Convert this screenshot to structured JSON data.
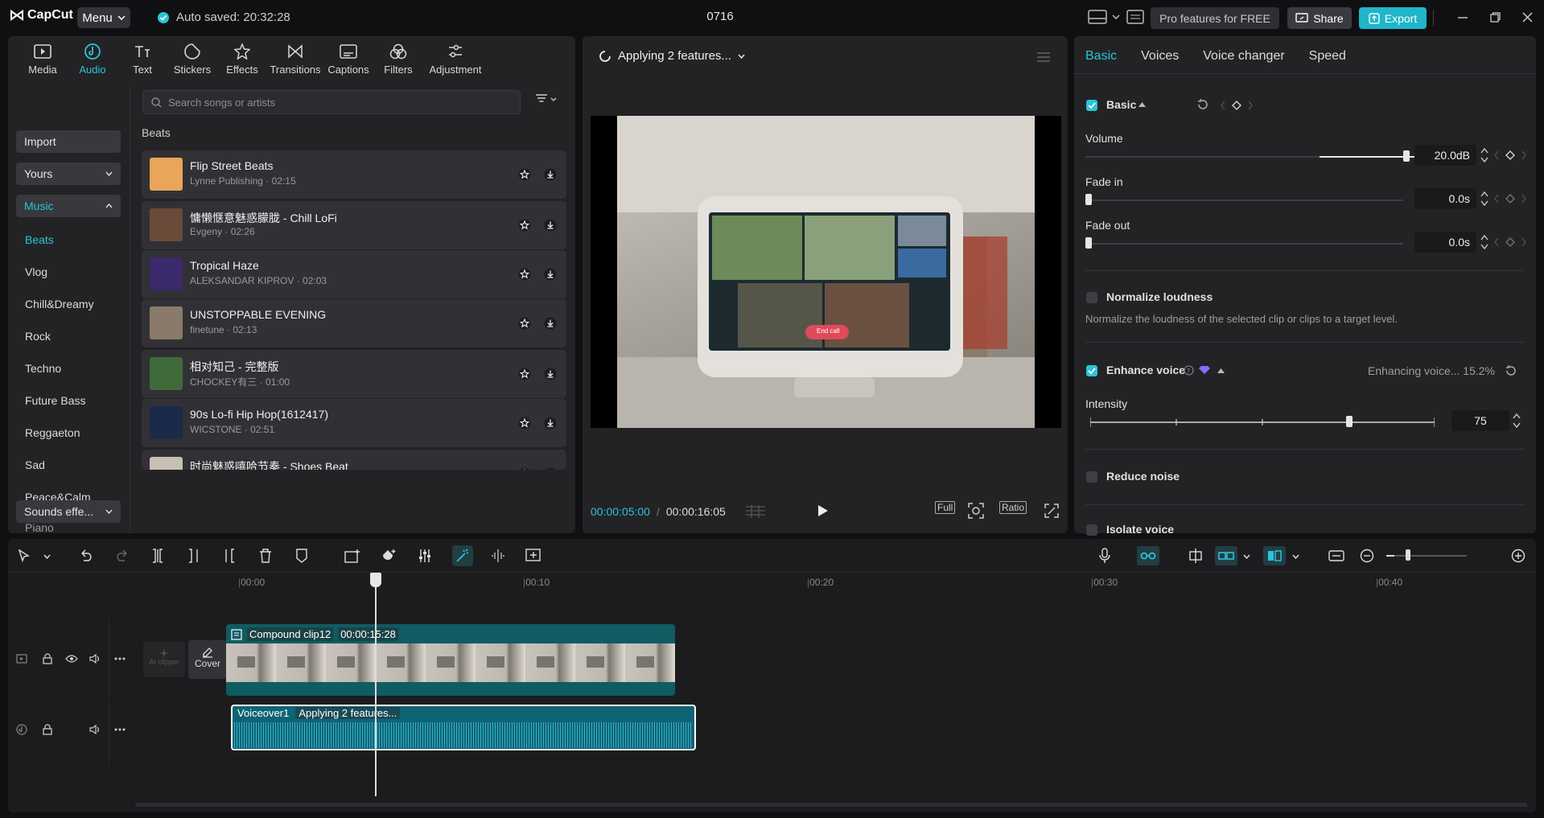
{
  "titlebar": {
    "logo": "CapCut",
    "menu": "Menu",
    "autosave": "Auto saved: 20:32:28",
    "project": "0716",
    "pro": "Pro features for FREE",
    "share": "Share",
    "export": "Export"
  },
  "tabs": [
    {
      "label": "Media",
      "icon": "media-icon"
    },
    {
      "label": "Audio",
      "icon": "audio-icon",
      "active": true
    },
    {
      "label": "Text",
      "icon": "text-icon"
    },
    {
      "label": "Stickers",
      "icon": "sticker-icon"
    },
    {
      "label": "Effects",
      "icon": "effects-icon"
    },
    {
      "label": "Transitions",
      "icon": "transition-icon"
    },
    {
      "label": "Captions",
      "icon": "captions-icon"
    },
    {
      "label": "Filters",
      "icon": "filters-icon"
    },
    {
      "label": "Adjustment",
      "icon": "adjustment-icon"
    }
  ],
  "sidebar": {
    "import": "Import",
    "yours": "Yours",
    "music": "Music",
    "items": [
      "Beats",
      "Vlog",
      "Chill&Dreamy",
      "Rock",
      "Techno",
      "Future Bass",
      "Reggaeton",
      "Sad",
      "Peace&Calm",
      "Piano"
    ],
    "sounds": "Sounds effe..."
  },
  "search": {
    "placeholder": "Search songs or artists"
  },
  "section": "Beats",
  "songs": [
    {
      "title": "Flip Street Beats",
      "sub": "Lynne Publishing · 02:15",
      "color": "#e9a55a"
    },
    {
      "title": "慵懒惬意魅惑朦胧 - Chill LoFi",
      "sub": "Evgeny · 02:26",
      "color": "#6b4a3a"
    },
    {
      "title": "Tropical Haze",
      "sub": "ALEKSANDAR KIPROV · 02:03",
      "color": "#3a2a6b"
    },
    {
      "title": "UNSTOPPABLE EVENING",
      "sub": "finetune · 02:13",
      "color": "#8a7a6a"
    },
    {
      "title": "相对知己 - 完整版",
      "sub": "CHOCKEY有三 · 01:00",
      "color": "#3f6b3a"
    },
    {
      "title": "90s Lo-fi Hip Hop(1612417)",
      "sub": "WICSTONE · 02:51",
      "color": "#1a2a4a"
    },
    {
      "title": "时尚魅惑嘻哈节奏 - Shoes Beat",
      "sub": "",
      "color": "#c9c0b5"
    }
  ],
  "preview": {
    "status": "Applying 2 features...",
    "current": "00:00:05:00",
    "total": "00:00:16:05",
    "full": "Full",
    "ratio": "Ratio",
    "end_call": "End call"
  },
  "inspector": {
    "tabs": [
      "Basic",
      "Voices",
      "Voice changer",
      "Speed"
    ],
    "basic": "Basic",
    "volume_label": "Volume",
    "volume": "20.0dB",
    "volume_level": 1.0,
    "fadein_label": "Fade in",
    "fadein": "0.0s",
    "fadeout_label": "Fade out",
    "fadeout": "0.0s",
    "normalize_label": "Normalize loudness",
    "normalize_desc": "Normalize the loudness of the selected clip or clips to a target level.",
    "enhance_label": "Enhance voice",
    "enhance_status": "Enhancing voice... 15.2%",
    "intensity_label": "Intensity",
    "intensity": "75",
    "reduce_label": "Reduce noise",
    "isolate_label": "Isolate voice"
  },
  "timeline": {
    "ruler": [
      "00:00",
      "00:10",
      "00:20",
      "00:30",
      "00:40"
    ],
    "ai_clipper": "AI clipper",
    "cover": "Cover",
    "video_clip": "Compound clip12",
    "video_dur": "00:00:15:28",
    "audio_clip": "Voiceover1",
    "audio_status": "Applying 2 features..."
  },
  "colors": {
    "accent": "#2bc4d6",
    "panel": "#232326"
  }
}
